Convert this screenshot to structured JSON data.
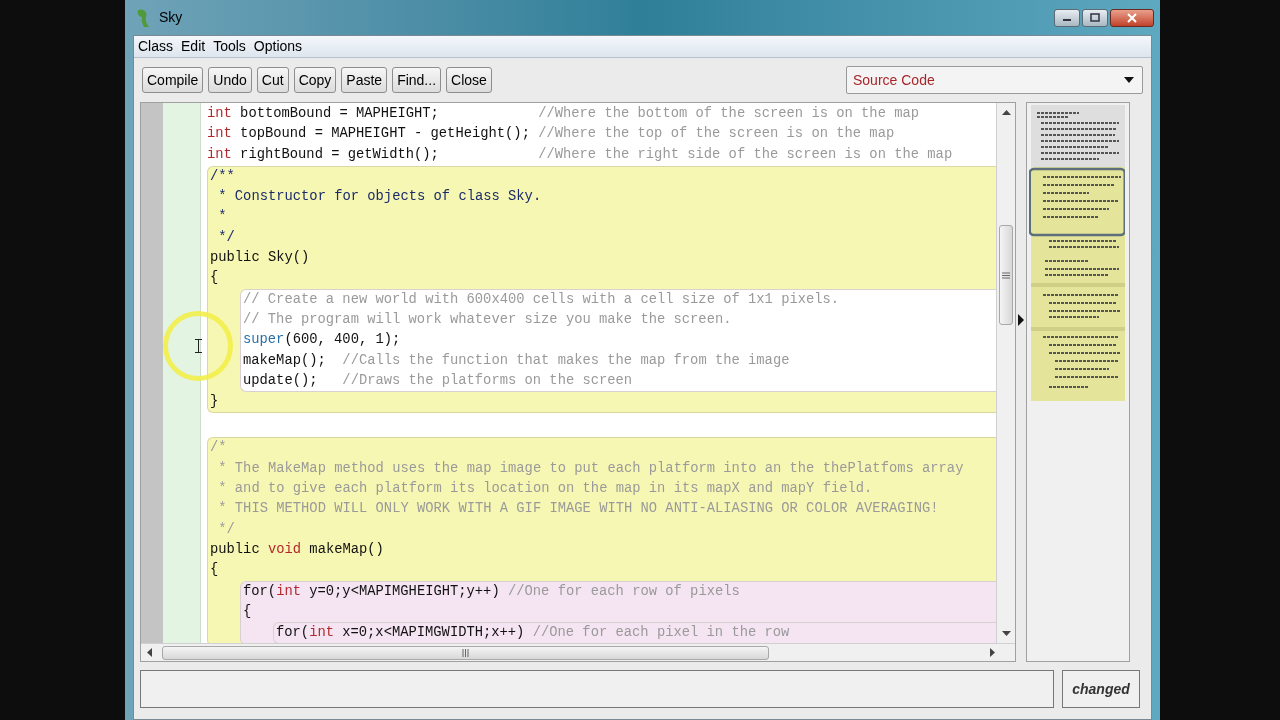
{
  "window": {
    "title": "Sky"
  },
  "menu": [
    "Class",
    "Edit",
    "Tools",
    "Options"
  ],
  "toolbar": [
    "Compile",
    "Undo",
    "Cut",
    "Copy",
    "Paste",
    "Find...",
    "Close"
  ],
  "view_selector": {
    "value": "Source Code"
  },
  "code": [
    {
      "kind": "line",
      "tokens": [
        {
          "kind": "keyword",
          "text": "int"
        },
        {
          "kind": "plain",
          "text": " bottomBound = MAPHEIGHT;            "
        },
        {
          "kind": "comment",
          "text": "//Where the bottom of the screen is on the map"
        }
      ]
    },
    {
      "kind": "line",
      "tokens": [
        {
          "kind": "keyword",
          "text": "int"
        },
        {
          "kind": "plain",
          "text": " topBound = MAPHEIGHT - getHeight(); "
        },
        {
          "kind": "comment",
          "text": "//Where the top of the screen is on the map"
        }
      ]
    },
    {
      "kind": "line",
      "tokens": [
        {
          "kind": "keyword",
          "text": "int"
        },
        {
          "kind": "plain",
          "text": " rightBound = getWidth();            "
        },
        {
          "kind": "comment",
          "text": "//Where the right side of the screen is on the map"
        }
      ]
    },
    {
      "kind": "scope",
      "color": "#f7f7b4",
      "items": [
        {
          "kind": "line",
          "tokens": [
            {
              "kind": "doc",
              "text": "/**"
            }
          ]
        },
        {
          "kind": "line",
          "tokens": [
            {
              "kind": "doc",
              "text": " * Constructor for objects of class Sky."
            }
          ]
        },
        {
          "kind": "line",
          "tokens": [
            {
              "kind": "doc",
              "text": " *"
            }
          ]
        },
        {
          "kind": "line",
          "tokens": [
            {
              "kind": "doc",
              "text": " */"
            }
          ]
        },
        {
          "kind": "line",
          "tokens": [
            {
              "kind": "plain",
              "text": "public Sky()"
            }
          ]
        },
        {
          "kind": "line",
          "tokens": [
            {
              "kind": "plain",
              "text": "{"
            }
          ]
        },
        {
          "kind": "scope",
          "color": "#ffffff",
          "items": [
            {
              "kind": "line",
              "tokens": [
                {
                  "kind": "comment",
                  "text": "// Create a new world with 600x400 cells with a cell size of 1x1 pixels."
                }
              ]
            },
            {
              "kind": "line",
              "tokens": [
                {
                  "kind": "comment",
                  "text": "// The program will work whatever size you make the screen."
                }
              ]
            },
            {
              "kind": "line",
              "tokens": [
                {
                  "kind": "call",
                  "text": "super"
                },
                {
                  "kind": "plain",
                  "text": "(600, 400, 1);"
                }
              ]
            },
            {
              "kind": "line",
              "tokens": [
                {
                  "kind": "plain",
                  "text": "makeMap();  "
                },
                {
                  "kind": "comment",
                  "text": "//Calls the function that makes the map from the image"
                }
              ]
            },
            {
              "kind": "line",
              "tokens": [
                {
                  "kind": "plain",
                  "text": "update();   "
                },
                {
                  "kind": "comment",
                  "text": "//Draws the platforms on the screen"
                }
              ]
            }
          ]
        },
        {
          "kind": "line",
          "tokens": [
            {
              "kind": "plain",
              "text": "}"
            }
          ]
        }
      ]
    },
    {
      "kind": "gap"
    },
    {
      "kind": "scope",
      "color": "#f7f7b4",
      "items": [
        {
          "kind": "line",
          "tokens": [
            {
              "kind": "comment",
              "text": "/*"
            }
          ]
        },
        {
          "kind": "line",
          "tokens": [
            {
              "kind": "comment",
              "text": " * The MakeMap method uses the map image to put each platform into an the thePlatfoms array"
            }
          ]
        },
        {
          "kind": "line",
          "tokens": [
            {
              "kind": "comment",
              "text": " * and to give each platform its location on the map in its mapX and mapY field."
            }
          ]
        },
        {
          "kind": "line",
          "tokens": [
            {
              "kind": "comment",
              "text": " * THIS METHOD WILL ONLY WORK WITH A GIF IMAGE WITH NO ANTI-ALIASING OR COLOR AVERAGING!"
            }
          ]
        },
        {
          "kind": "line",
          "tokens": [
            {
              "kind": "comment",
              "text": " */"
            }
          ]
        },
        {
          "kind": "line",
          "tokens": [
            {
              "kind": "plain",
              "text": "public "
            },
            {
              "kind": "keyword",
              "text": "void"
            },
            {
              "kind": "plain",
              "text": " makeMap()"
            }
          ]
        },
        {
          "kind": "line",
          "tokens": [
            {
              "kind": "plain",
              "text": "{"
            }
          ]
        },
        {
          "kind": "scope",
          "color": "#f5e4f2",
          "items": [
            {
              "kind": "line",
              "tokens": [
                {
                  "kind": "plain",
                  "text": "for("
                },
                {
                  "kind": "keyword",
                  "text": "int"
                },
                {
                  "kind": "plain",
                  "text": " y=0;y<MAPIMGHEIGHT;y++) "
                },
                {
                  "kind": "comment",
                  "text": "//One for each row of pixels"
                }
              ]
            },
            {
              "kind": "line",
              "tokens": [
                {
                  "kind": "plain",
                  "text": "{"
                }
              ]
            },
            {
              "kind": "scope",
              "color": "#f5e4f2",
              "items": [
                {
                  "kind": "line",
                  "tokens": [
                    {
                      "kind": "plain",
                      "text": "for("
                    },
                    {
                      "kind": "keyword",
                      "text": "int"
                    },
                    {
                      "kind": "plain",
                      "text": " x=0;x<MAPIMGWIDTH;x++) "
                    },
                    {
                      "kind": "comment",
                      "text": "//One for each pixel in the row"
                    }
                  ]
                }
              ]
            }
          ]
        }
      ]
    }
  ],
  "status": {
    "state": "changed"
  }
}
